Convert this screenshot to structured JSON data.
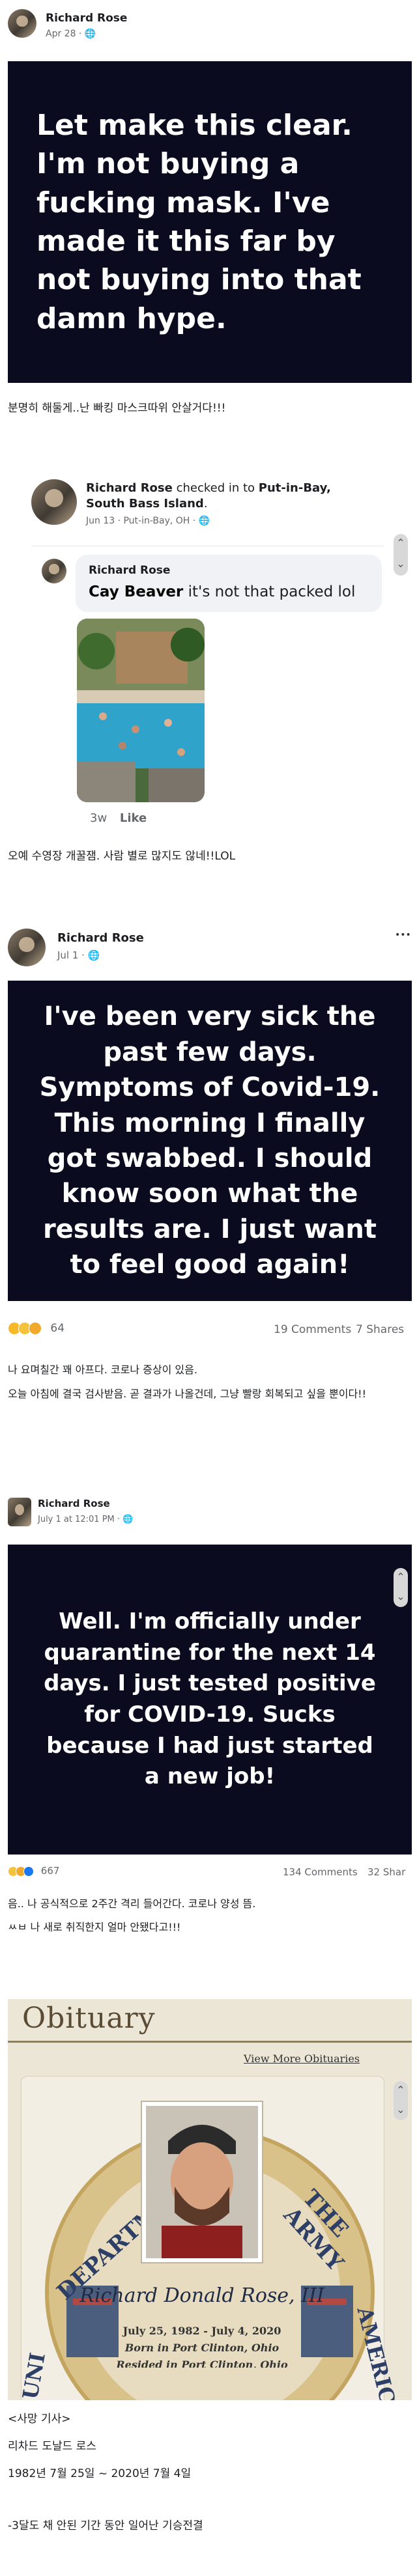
{
  "post1": {
    "author": "Richard Rose",
    "date": "Apr 28 · ",
    "image_text": "Let make this clear. I'm not buying a fucking mask. I've made it this far by not buying into that damn hype.",
    "caption": "분명히 해둘게..난 빠킹 마스크따위 안살거다!!!"
  },
  "post2": {
    "author": "Richard Rose",
    "checkin_mid": " checked in to ",
    "place": "Put-in-Bay, South Bass Island",
    "place_end": ".",
    "date": "Jun 13 · Put-in-Bay, OH · ",
    "comment_author": "Richard Rose",
    "comment_tag": "Cay Beaver",
    "comment_text": " it's not that packed lol",
    "comment_age": "3w",
    "comment_like": "Like",
    "caption": "오예 수영장 개꿀잼. 사람 별로 많지도 않네!!LOL"
  },
  "post3": {
    "author": "Richard Rose",
    "date": "Jul 1 · ",
    "more": "•••",
    "image_text": "I've been very sick the past few days. Symptoms of Covid-19. This morning I finally got swabbed. I should know soon what the results are. I just want to feel good again!",
    "reaction_count": "64",
    "comments": "19 Comments",
    "shares": "7 Shares",
    "caption_line1": "나 요며칠간 꽤 아프다. 코로나 증상이 있음.",
    "caption_line2": "오늘 아침에 결국 검사받음. 곧 결과가 나올건데, 그냥 빨랑 회복되고 싶을 뿐이다!!"
  },
  "post4": {
    "author": "Richard Rose",
    "date": "July 1 at 12:01 PM · ",
    "image_text": "Well. I'm officially under quarantine for the next 14 days. I just tested positive for COVID-19. Sucks because I had just started a new job!",
    "reaction_count": "667",
    "comments": "134 Comments",
    "shares": "32 Shar",
    "caption_line1": "음.. 나 공식적으로 2주간 격리 들어간다. 코로나 양성 뜸.",
    "caption_line2": "ㅆㅂ 나 새로 취직한지 얼마 안됐다고!!!"
  },
  "obituary": {
    "title": "Obituary",
    "link": "View More Obituaries",
    "seal_left": "DEPARTM",
    "seal_right": "THE ARMY",
    "seal_bottom_left": "UNI",
    "seal_bottom_right": "AMERICA",
    "name": "Richard Donald Rose, III",
    "dates": "July 25, 1982 - July 4, 2020",
    "born": "Born in Port Clinton, Ohio",
    "resided": "Resided in Port Clinton, Ohio"
  },
  "footer": {
    "line1": "<사망 기사>",
    "line2": "리차드 도날드 로스",
    "line3": "1982년 7월 25일 ~ 2020년 7월 4일",
    "line4": "-3달도 채 안된 기간 동안 일어난 기승전결"
  },
  "colors": {
    "card_bg": "#0b0b20",
    "like_blue": "#1877f2",
    "haha_yellow": "#f7b928",
    "sad_yellow": "#f5c33b",
    "obituary_bg": "#ece6d6",
    "obituary_title": "#5a4b35"
  },
  "icons": [
    "globe-icon",
    "more-dots-icon",
    "scroll-up-icon",
    "scroll-down-icon",
    "like-reaction-icon",
    "haha-reaction-icon",
    "sad-reaction-icon",
    "wow-reaction-icon",
    "flag-icon"
  ]
}
